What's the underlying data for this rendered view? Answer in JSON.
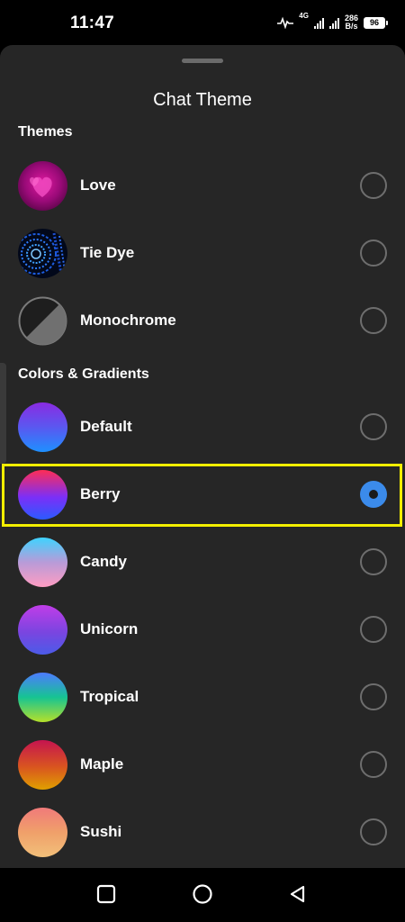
{
  "status_bar": {
    "time": "11:47",
    "network_type": "4G",
    "speed_value": "286",
    "speed_unit": "B/s",
    "battery": "96"
  },
  "sheet": {
    "title": "Chat Theme"
  },
  "sections": {
    "themes_label": "Themes",
    "colors_label": "Colors & Gradients"
  },
  "themes": [
    {
      "label": "Love",
      "selected": false
    },
    {
      "label": "Tie Dye",
      "selected": false
    },
    {
      "label": "Monochrome",
      "selected": false
    }
  ],
  "colors": [
    {
      "label": "Default",
      "selected": false,
      "gradient": [
        "#8a2be2",
        "#1e90ff"
      ]
    },
    {
      "label": "Berry",
      "selected": true,
      "gradient": [
        "#ff2d55",
        "#7b2ff7",
        "#2b5bff"
      ]
    },
    {
      "label": "Candy",
      "selected": false,
      "gradient": [
        "#3ed3ff",
        "#b89bd8",
        "#ff9cc2"
      ]
    },
    {
      "label": "Unicorn",
      "selected": false,
      "gradient": [
        "#c03de8",
        "#7a45e0",
        "#4b5be8"
      ]
    },
    {
      "label": "Tropical",
      "selected": false,
      "gradient": [
        "#4d7bff",
        "#16c492",
        "#b5e02a"
      ]
    },
    {
      "label": "Maple",
      "selected": false,
      "gradient": [
        "#c5144f",
        "#d9561f",
        "#e0a000"
      ]
    },
    {
      "label": "Sushi",
      "selected": false,
      "gradient": [
        "#f07a7a",
        "#f0a06a",
        "#f2c07a"
      ]
    }
  ],
  "colors_meta": {
    "selected_radio": "#3b8beb",
    "highlight_border": "#f2ee00",
    "sheet_background": "#262626"
  },
  "nav": {
    "recents_icon": "square-icon",
    "home_icon": "circle-icon",
    "back_icon": "triangle-back-icon"
  }
}
